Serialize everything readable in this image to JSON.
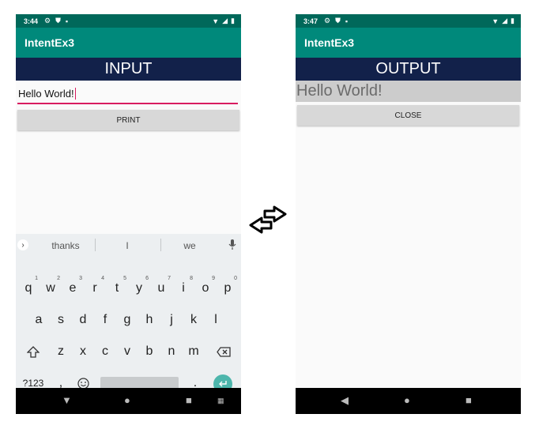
{
  "left": {
    "status_time": "3:44",
    "app_title": "IntentEx3",
    "banner": "INPUT",
    "input_value": "Hello World!",
    "print_label": "PRINT",
    "keyboard": {
      "suggestions": [
        "thanks",
        "I",
        "we"
      ],
      "row1": [
        [
          "q",
          "1"
        ],
        [
          "w",
          "2"
        ],
        [
          "e",
          "3"
        ],
        [
          "r",
          "4"
        ],
        [
          "t",
          "5"
        ],
        [
          "y",
          "6"
        ],
        [
          "u",
          "7"
        ],
        [
          "i",
          "8"
        ],
        [
          "o",
          "9"
        ],
        [
          "p",
          "0"
        ]
      ],
      "row2": [
        "a",
        "s",
        "d",
        "f",
        "g",
        "h",
        "j",
        "k",
        "l"
      ],
      "row3": [
        "z",
        "x",
        "c",
        "v",
        "b",
        "n",
        "m"
      ],
      "symbols": "?123",
      "comma": ",",
      "period": "."
    }
  },
  "right": {
    "status_time": "3:47",
    "app_title": "IntentEx3",
    "banner": "OUTPUT",
    "output_text": "Hello World!",
    "close_label": "CLOSE"
  },
  "colors": {
    "status_bar": "#00685a",
    "app_bar": "#00897b",
    "banner": "#12214a",
    "accent": "#d81b60",
    "enter_key": "#4db6ac"
  },
  "icons": {
    "swap": "swap-arrows-icon",
    "mic": "microphone-icon",
    "backspace": "backspace-icon",
    "shift": "shift-icon",
    "emoji": "emoji-icon"
  }
}
